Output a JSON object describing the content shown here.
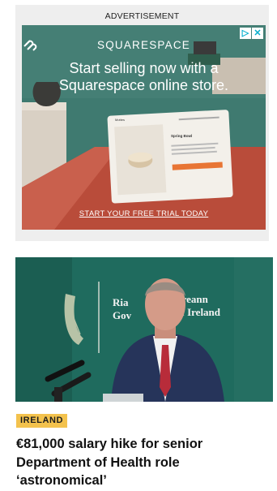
{
  "ad": {
    "label": "ADVERTISEMENT",
    "adchoices_icon": "adchoices-icon",
    "close_icon": "close-icon",
    "brand": "SQUARESPACE",
    "headline": "Start selling now with a Squarespace online store.",
    "cta": "START YOUR FREE TRIAL TODAY",
    "mockup": {
      "brand": "Mottes",
      "product_title": "Spring Bowl"
    }
  },
  "article": {
    "category": "IRELAND",
    "title": "€81,000 salary hike for senior Department of Health role ‘astronomical’",
    "photo_sign_text": [
      "Ria",
      "Gov",
      "ireann",
      "of Ireland"
    ]
  },
  "colors": {
    "ad_background": "#3f7a70",
    "badge": "#f3c24d",
    "podium": "#c0533f"
  }
}
